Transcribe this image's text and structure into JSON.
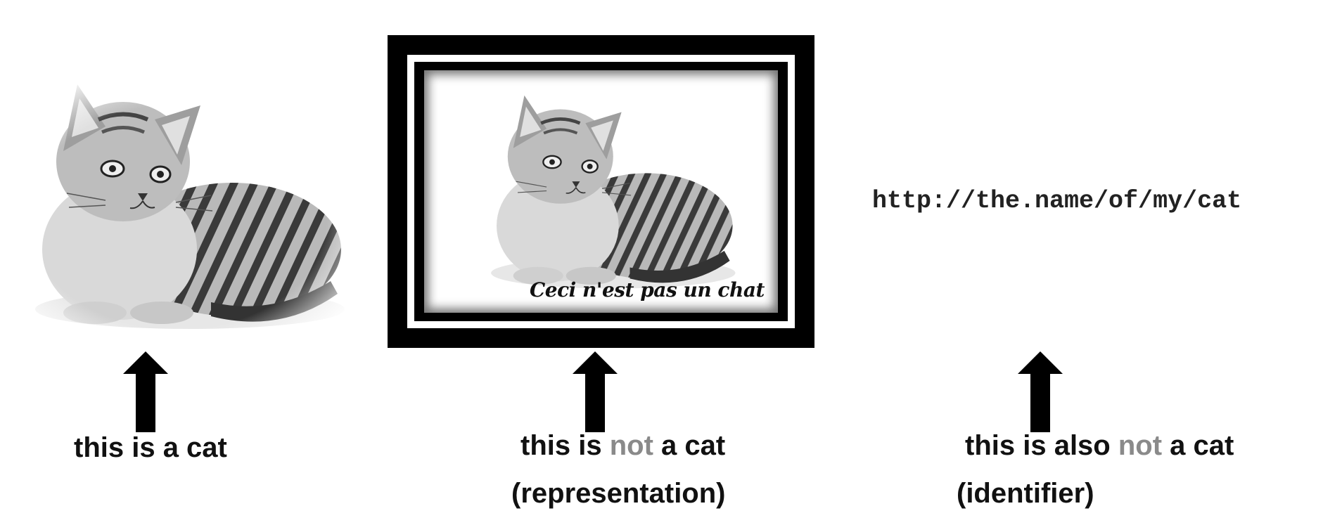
{
  "panels": [
    {
      "label_prefix": "this is a cat",
      "label_muted": "",
      "label_suffix": "",
      "sublabel": ""
    },
    {
      "frame_caption": "Ceci n'est pas un chat",
      "label_prefix": "this is ",
      "label_muted": "not",
      "label_suffix": " a cat",
      "sublabel": "(representation)"
    },
    {
      "uri": "http://the.name/of/my/cat",
      "label_prefix": "this is also ",
      "label_muted": "not",
      "label_suffix": " a cat",
      "sublabel": "(identifier)"
    }
  ],
  "colors": {
    "text": "#111111",
    "muted": "#8a8a8a",
    "frame": "#000000"
  }
}
